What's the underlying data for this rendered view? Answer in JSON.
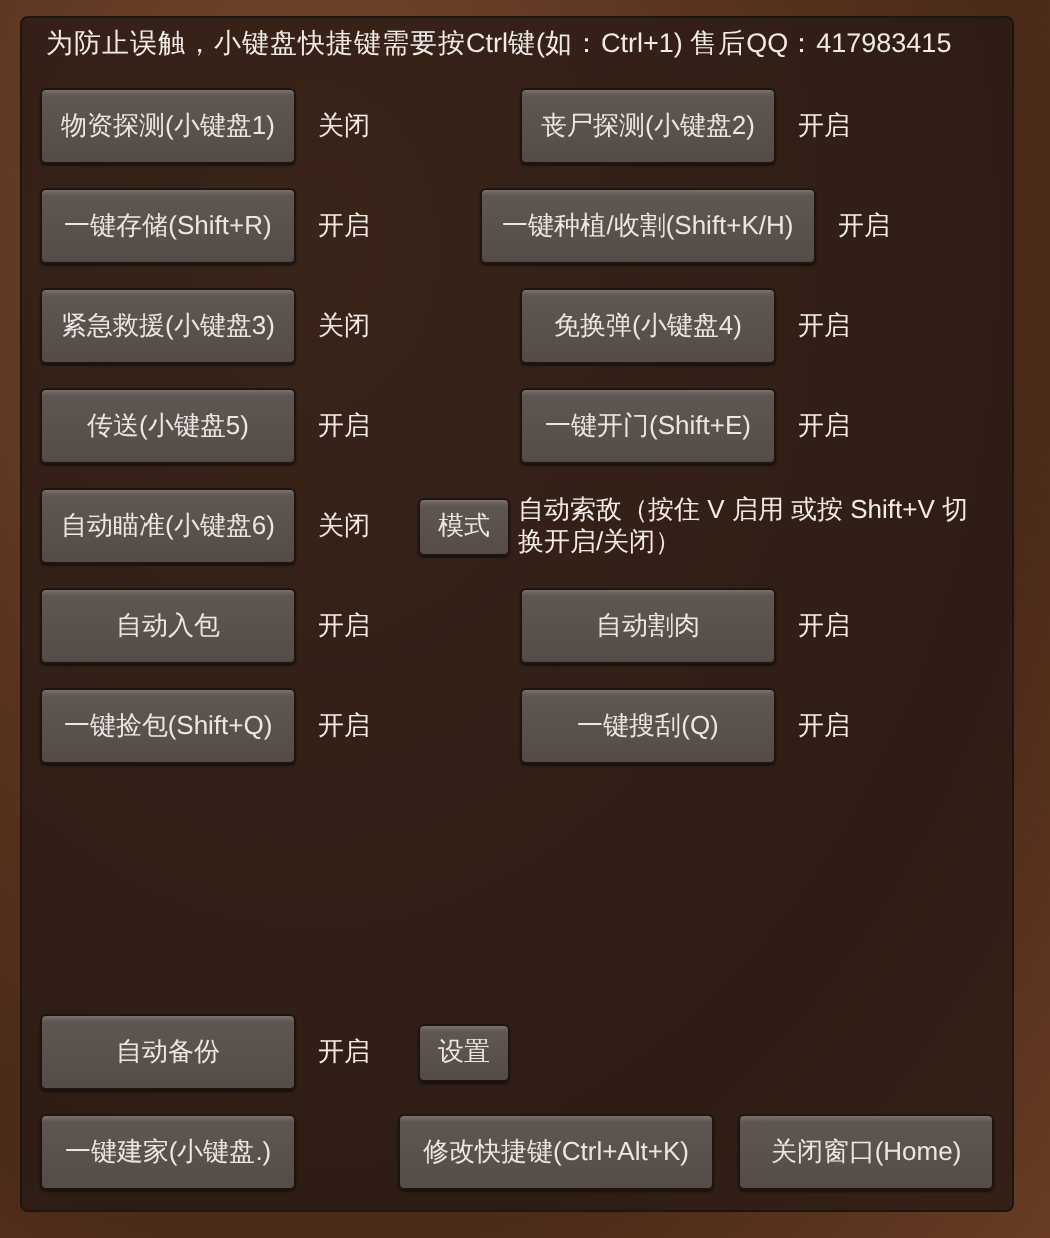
{
  "notice": "为防止误触，小键盘快捷键需要按Ctrl键(如：Ctrl+1) 售后QQ：417983415",
  "rows": [
    {
      "left": {
        "label": "物资探测(小键盘1)",
        "status": "关闭"
      },
      "right": {
        "kind": "toggle",
        "label": "丧尸探测(小键盘2)",
        "status": "开启"
      }
    },
    {
      "left": {
        "label": "一键存储(Shift+R)",
        "status": "开启"
      },
      "right": {
        "kind": "wide-toggle",
        "label": "一键种植/收割(Shift+K/H)",
        "status": "开启"
      }
    },
    {
      "left": {
        "label": "紧急救援(小键盘3)",
        "status": "关闭"
      },
      "right": {
        "kind": "toggle",
        "label": "免换弹(小键盘4)",
        "status": "开启"
      }
    },
    {
      "left": {
        "label": "传送(小键盘5)",
        "status": "开启"
      },
      "right": {
        "kind": "toggle",
        "label": "一键开门(Shift+E)",
        "status": "开启"
      }
    },
    {
      "left": {
        "label": "自动瞄准(小键盘6)",
        "status": "关闭"
      },
      "right": {
        "kind": "mode",
        "label": "模式",
        "description": "自动索敌（按住 V 启用 或按 Shift+V 切换开启/关闭）"
      }
    },
    {
      "left": {
        "label": "自动入包",
        "status": "开启"
      },
      "right": {
        "kind": "toggle",
        "label": "自动割肉",
        "status": "开启"
      }
    },
    {
      "left": {
        "label": "一键捡包(Shift+Q)",
        "status": "开启"
      },
      "right": {
        "kind": "toggle",
        "label": "一键搜刮(Q)",
        "status": "开启"
      }
    }
  ],
  "backup": {
    "label": "自动备份",
    "status": "开启",
    "settings": "设置"
  },
  "footer": {
    "build": "一键建家(小键盘.)",
    "hotkeys": "修改快捷键(Ctrl+Alt+K)",
    "close": "关闭窗口(Home)"
  }
}
